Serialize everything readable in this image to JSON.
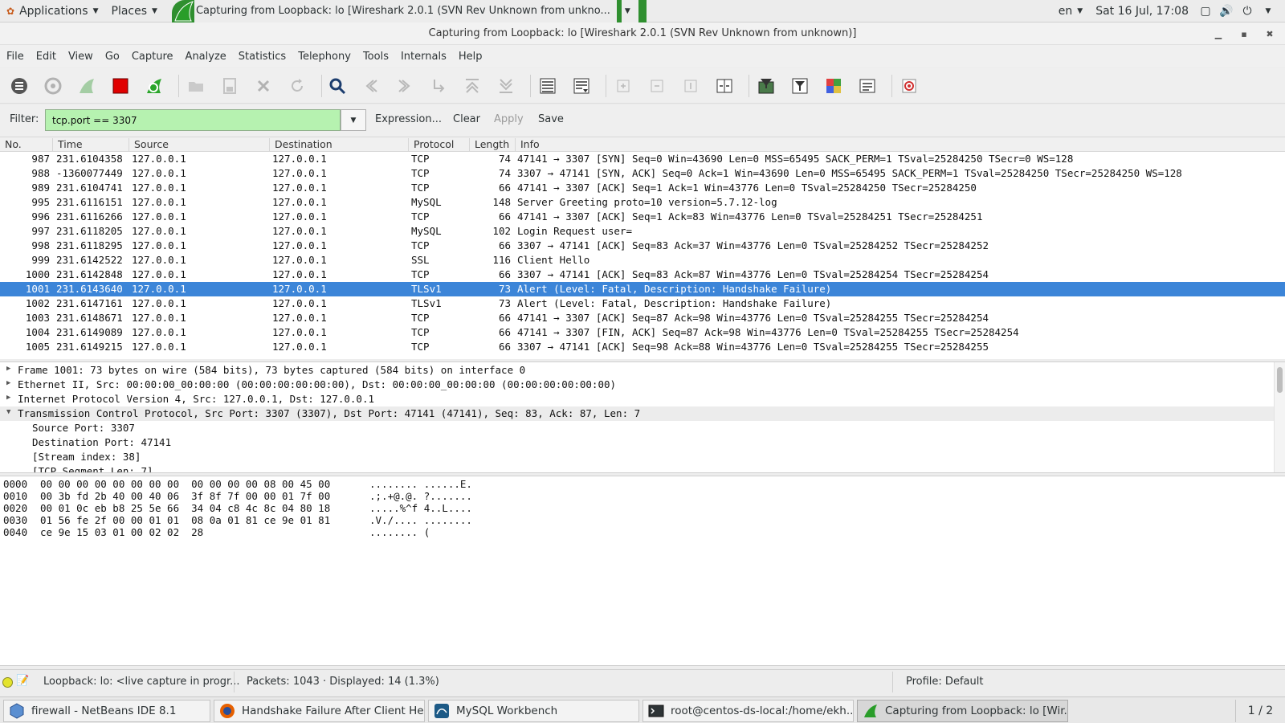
{
  "topbar": {
    "applications": "Applications",
    "places": "Places",
    "active_window": "Capturing from Loopback: lo [Wireshark 2.0.1 (SVN Rev Unknown from unkno...",
    "lang": "en",
    "clock": "Sat 16 Jul, 17:08"
  },
  "window": {
    "title": "Capturing from Loopback: lo [Wireshark 2.0.1 (SVN Rev Unknown from unknown)]"
  },
  "menu": [
    "File",
    "Edit",
    "View",
    "Go",
    "Capture",
    "Analyze",
    "Statistics",
    "Telephony",
    "Tools",
    "Internals",
    "Help"
  ],
  "filter": {
    "label": "Filter:",
    "value": "tcp.port == 3307",
    "expression": "Expression...",
    "clear": "Clear",
    "apply": "Apply",
    "save": "Save"
  },
  "packet_list": {
    "columns": [
      "No.",
      "Time",
      "Source",
      "Destination",
      "Protocol",
      "Length",
      "Info"
    ],
    "rows": [
      {
        "no": "987",
        "time": "231.6104358",
        "src": "127.0.0.1",
        "dst": "127.0.0.1",
        "proto": "TCP",
        "len": "74",
        "info": "47141 → 3307 [SYN] Seq=0 Win=43690 Len=0 MSS=65495 SACK_PERM=1 TSval=25284250 TSecr=0 WS=128"
      },
      {
        "no": "988",
        "time": "-1360077449",
        "src": "127.0.0.1",
        "dst": "127.0.0.1",
        "proto": "TCP",
        "len": "74",
        "info": "3307 → 47141 [SYN, ACK] Seq=0 Ack=1 Win=43690 Len=0 MSS=65495 SACK_PERM=1 TSval=25284250 TSecr=25284250 WS=128"
      },
      {
        "no": "989",
        "time": "231.6104741",
        "src": "127.0.0.1",
        "dst": "127.0.0.1",
        "proto": "TCP",
        "len": "66",
        "info": "47141 → 3307 [ACK] Seq=1 Ack=1 Win=43776 Len=0 TSval=25284250 TSecr=25284250"
      },
      {
        "no": "995",
        "time": "231.6116151",
        "src": "127.0.0.1",
        "dst": "127.0.0.1",
        "proto": "MySQL",
        "len": "148",
        "info": "Server Greeting proto=10 version=5.7.12-log"
      },
      {
        "no": "996",
        "time": "231.6116266",
        "src": "127.0.0.1",
        "dst": "127.0.0.1",
        "proto": "TCP",
        "len": "66",
        "info": "47141 → 3307 [ACK] Seq=1 Ack=83 Win=43776 Len=0 TSval=25284251 TSecr=25284251"
      },
      {
        "no": "997",
        "time": "231.6118205",
        "src": "127.0.0.1",
        "dst": "127.0.0.1",
        "proto": "MySQL",
        "len": "102",
        "info": "Login Request user="
      },
      {
        "no": "998",
        "time": "231.6118295",
        "src": "127.0.0.1",
        "dst": "127.0.0.1",
        "proto": "TCP",
        "len": "66",
        "info": "3307 → 47141 [ACK] Seq=83 Ack=37 Win=43776 Len=0 TSval=25284252 TSecr=25284252"
      },
      {
        "no": "999",
        "time": "231.6142522",
        "src": "127.0.0.1",
        "dst": "127.0.0.1",
        "proto": "SSL",
        "len": "116",
        "info": "Client Hello"
      },
      {
        "no": "1000",
        "time": "231.6142848",
        "src": "127.0.0.1",
        "dst": "127.0.0.1",
        "proto": "TCP",
        "len": "66",
        "info": "3307 → 47141 [ACK] Seq=83 Ack=87 Win=43776 Len=0 TSval=25284254 TSecr=25284254"
      },
      {
        "no": "1001",
        "time": "231.6143640",
        "src": "127.0.0.1",
        "dst": "127.0.0.1",
        "proto": "TLSv1",
        "len": "73",
        "info": "Alert (Level: Fatal, Description: Handshake Failure)"
      },
      {
        "no": "1002",
        "time": "231.6147161",
        "src": "127.0.0.1",
        "dst": "127.0.0.1",
        "proto": "TLSv1",
        "len": "73",
        "info": "Alert (Level: Fatal, Description: Handshake Failure)"
      },
      {
        "no": "1003",
        "time": "231.6148671",
        "src": "127.0.0.1",
        "dst": "127.0.0.1",
        "proto": "TCP",
        "len": "66",
        "info": "47141 → 3307 [ACK] Seq=87 Ack=98 Win=43776 Len=0 TSval=25284255 TSecr=25284254"
      },
      {
        "no": "1004",
        "time": "231.6149089",
        "src": "127.0.0.1",
        "dst": "127.0.0.1",
        "proto": "TCP",
        "len": "66",
        "info": "47141 → 3307 [FIN, ACK] Seq=87 Ack=98 Win=43776 Len=0 TSval=25284255 TSecr=25284254"
      },
      {
        "no": "1005",
        "time": "231.6149215",
        "src": "127.0.0.1",
        "dst": "127.0.0.1",
        "proto": "TCP",
        "len": "66",
        "info": "3307 → 47141 [ACK] Seq=98 Ack=88 Win=43776 Len=0 TSval=25284255 TSecr=25284255"
      }
    ],
    "selected_no": "1001",
    "selected_color": "#3c85d8"
  },
  "details": {
    "rows": [
      {
        "text": "Frame 1001: 73 bytes on wire (584 bits), 73 bytes captured (584 bits) on interface 0",
        "state": "collapsed"
      },
      {
        "text": "Ethernet II, Src: 00:00:00_00:00:00 (00:00:00:00:00:00), Dst: 00:00:00_00:00:00 (00:00:00:00:00:00)",
        "state": "collapsed"
      },
      {
        "text": "Internet Protocol Version 4, Src: 127.0.0.1, Dst: 127.0.0.1",
        "state": "collapsed"
      },
      {
        "text": "Transmission Control Protocol, Src Port: 3307 (3307), Dst Port: 47141 (47141), Seq: 83, Ack: 87, Len: 7",
        "state": "expanded"
      },
      {
        "text": "Source Port: 3307",
        "state": "child"
      },
      {
        "text": "Destination Port: 47141",
        "state": "child"
      },
      {
        "text": "[Stream index: 38]",
        "state": "child"
      },
      {
        "text": "[TCP Segment Len: 7]",
        "state": "child"
      }
    ]
  },
  "bytes": {
    "rows": [
      {
        "offset": "0000",
        "hex": "00 00 00 00 00 00 00 00  00 00 00 00 08 00 45 00",
        "ascii": "........ ......E."
      },
      {
        "offset": "0010",
        "hex": "00 3b fd 2b 40 00 40 06  3f 8f 7f 00 00 01 7f 00",
        "ascii": ".;.+@.@. ?......."
      },
      {
        "offset": "0020",
        "hex": "00 01 0c eb b8 25 5e 66  34 04 c8 4c 8c 04 80 18",
        "ascii": ".....%^f 4..L...."
      },
      {
        "offset": "0030",
        "hex": "01 56 fe 2f 00 00 01 01  08 0a 01 81 ce 9e 01 81",
        "ascii": ".V./.... ........"
      },
      {
        "offset": "0040",
        "hex": "ce 9e 15 03 01 00 02 02  28",
        "ascii": "........ ("
      }
    ]
  },
  "status": {
    "interface": "Loopback: lo: <live capture in progr...",
    "packets": "Packets: 1043 · Displayed: 14 (1.3%)",
    "profile": "Profile: Default"
  },
  "taskbar": {
    "items": [
      {
        "label": "firewall - NetBeans IDE 8.1",
        "icon": "netbeans-icon"
      },
      {
        "label": "Handshake Failure After Client He...",
        "icon": "firefox-icon"
      },
      {
        "label": "MySQL Workbench",
        "icon": "mysql-workbench-icon"
      },
      {
        "label": "root@centos-ds-local:/home/ekh...",
        "icon": "terminal-icon"
      },
      {
        "label": "Capturing from Loopback: lo [Wir...",
        "icon": "wireshark-icon"
      }
    ],
    "pager": "1 / 2"
  }
}
